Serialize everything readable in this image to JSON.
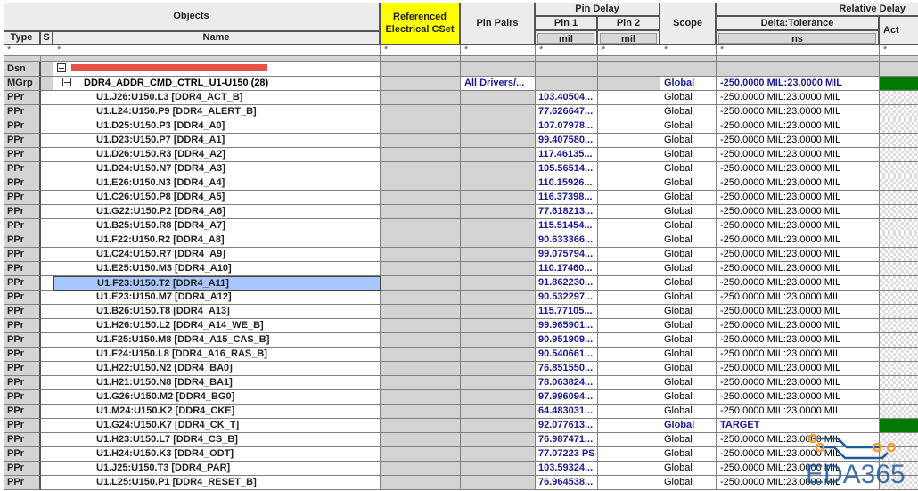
{
  "headers": {
    "objects": "Objects",
    "type": "Type",
    "s": "S",
    "name": "Name",
    "ref_cset": "Referenced Electrical CSet",
    "pin_pairs": "Pin Pairs",
    "pin_delay": "Pin Delay",
    "pin1": "Pin 1",
    "pin2": "Pin 2",
    "pin1_unit": "mil",
    "pin2_unit": "mil",
    "scope": "Scope",
    "relative_delay": "Relative Delay",
    "delta_tolerance": "Delta:Tolerance",
    "delta_unit": "ns",
    "actual": "Act",
    "filter": "*"
  },
  "design_row": {
    "type": "Dsn",
    "name": "[redacted]"
  },
  "group_row": {
    "type": "MGrp",
    "name": "DDR4_ADDR_CMD_CTRL_U1-U150 (28)",
    "pin_pairs": "All Drivers/...",
    "scope": "Global",
    "delta": "-250.0000 MIL:23.0000 MIL",
    "actual_status": "pass"
  },
  "colors": {
    "pass": "#007a00",
    "selected": "#a8c6ff",
    "header_yellow": "#ffff00",
    "value_blue": "#1a1a8c"
  },
  "rows": [
    {
      "type": "PPr",
      "name": "U1.J26:U150.L3 [DDR4_ACT_B]",
      "pin1": "103.40504...",
      "scope": "Global",
      "delta": "-250.0000 MIL:23.0000 MIL"
    },
    {
      "type": "PPr",
      "name": "U1.L24:U150.P9 [DDR4_ALERT_B]",
      "pin1": "77.626647...",
      "scope": "Global",
      "delta": "-250.0000 MIL:23.0000 MIL"
    },
    {
      "type": "PPr",
      "name": "U1.D25:U150.P3 [DDR4_A0]",
      "pin1": "107.07978...",
      "scope": "Global",
      "delta": "-250.0000 MIL:23.0000 MIL"
    },
    {
      "type": "PPr",
      "name": "U1.D23:U150.P7 [DDR4_A1]",
      "pin1": "99.407580...",
      "scope": "Global",
      "delta": "-250.0000 MIL:23.0000 MIL"
    },
    {
      "type": "PPr",
      "name": "U1.D26:U150.R3 [DDR4_A2]",
      "pin1": "117.46135...",
      "scope": "Global",
      "delta": "-250.0000 MIL:23.0000 MIL"
    },
    {
      "type": "PPr",
      "name": "U1.D24:U150.N7 [DDR4_A3]",
      "pin1": "105.56514...",
      "scope": "Global",
      "delta": "-250.0000 MIL:23.0000 MIL"
    },
    {
      "type": "PPr",
      "name": "U1.E26:U150.N3 [DDR4_A4]",
      "pin1": "110.15926...",
      "scope": "Global",
      "delta": "-250.0000 MIL:23.0000 MIL"
    },
    {
      "type": "PPr",
      "name": "U1.C26:U150.P8 [DDR4_A5]",
      "pin1": "116.37398...",
      "scope": "Global",
      "delta": "-250.0000 MIL:23.0000 MIL"
    },
    {
      "type": "PPr",
      "name": "U1.G22:U150.P2 [DDR4_A6]",
      "pin1": "77.618213...",
      "scope": "Global",
      "delta": "-250.0000 MIL:23.0000 MIL"
    },
    {
      "type": "PPr",
      "name": "U1.B25:U150.R8 [DDR4_A7]",
      "pin1": "115.51454...",
      "scope": "Global",
      "delta": "-250.0000 MIL:23.0000 MIL"
    },
    {
      "type": "PPr",
      "name": "U1.F22:U150.R2 [DDR4_A8]",
      "pin1": "90.633366...",
      "scope": "Global",
      "delta": "-250.0000 MIL:23.0000 MIL"
    },
    {
      "type": "PPr",
      "name": "U1.C24:U150.R7 [DDR4_A9]",
      "pin1": "99.075794...",
      "scope": "Global",
      "delta": "-250.0000 MIL:23.0000 MIL"
    },
    {
      "type": "PPr",
      "name": "U1.E25:U150.M3 [DDR4_A10]",
      "pin1": "110.17460...",
      "scope": "Global",
      "delta": "-250.0000 MIL:23.0000 MIL"
    },
    {
      "type": "PPr",
      "name": "U1.F23:U150.T2 [DDR4_A11]",
      "pin1": "91.862230...",
      "scope": "Global",
      "delta": "-250.0000 MIL:23.0000 MIL",
      "selected": true
    },
    {
      "type": "PPr",
      "name": "U1.E23:U150.M7 [DDR4_A12]",
      "pin1": "90.532297...",
      "scope": "Global",
      "delta": "-250.0000 MIL:23.0000 MIL"
    },
    {
      "type": "PPr",
      "name": "U1.B26:U150.T8 [DDR4_A13]",
      "pin1": "115.77105...",
      "scope": "Global",
      "delta": "-250.0000 MIL:23.0000 MIL"
    },
    {
      "type": "PPr",
      "name": "U1.H26:U150.L2 [DDR4_A14_WE_B]",
      "pin1": "99.965901...",
      "scope": "Global",
      "delta": "-250.0000 MIL:23.0000 MIL"
    },
    {
      "type": "PPr",
      "name": "U1.F25:U150.M8 [DDR4_A15_CAS_B]",
      "pin1": "90.951909...",
      "scope": "Global",
      "delta": "-250.0000 MIL:23.0000 MIL"
    },
    {
      "type": "PPr",
      "name": "U1.F24:U150.L8 [DDR4_A16_RAS_B]",
      "pin1": "90.540661...",
      "scope": "Global",
      "delta": "-250.0000 MIL:23.0000 MIL"
    },
    {
      "type": "PPr",
      "name": "U1.H22:U150.N2 [DDR4_BA0]",
      "pin1": "76.851550...",
      "scope": "Global",
      "delta": "-250.0000 MIL:23.0000 MIL"
    },
    {
      "type": "PPr",
      "name": "U1.H21:U150.N8 [DDR4_BA1]",
      "pin1": "78.063824...",
      "scope": "Global",
      "delta": "-250.0000 MIL:23.0000 MIL"
    },
    {
      "type": "PPr",
      "name": "U1.G26:U150.M2 [DDR4_BG0]",
      "pin1": "97.996094...",
      "scope": "Global",
      "delta": "-250.0000 MIL:23.0000 MIL"
    },
    {
      "type": "PPr",
      "name": "U1.M24:U150.K2 [DDR4_CKE]",
      "pin1": "64.483031...",
      "scope": "Global",
      "delta": "-250.0000 MIL:23.0000 MIL"
    },
    {
      "type": "PPr",
      "name": "U1.G24:U150.K7 [DDR4_CK_T]",
      "pin1": "92.077613...",
      "scope": "Global",
      "delta": "TARGET",
      "target": true
    },
    {
      "type": "PPr",
      "name": "U1.H23:U150.L7 [DDR4_CS_B]",
      "pin1": "76.987471...",
      "scope": "Global",
      "delta": "-250.0000 MIL:23.0000 MIL"
    },
    {
      "type": "PPr",
      "name": "U1.H24:U150.K3 [DDR4_ODT]",
      "pin1": "77.07223 PS",
      "scope": "Global",
      "delta": "-250.0000 MIL:23.0000 MIL"
    },
    {
      "type": "PPr",
      "name": "U1.J25:U150.T3 [DDR4_PAR]",
      "pin1": "103.59324...",
      "scope": "Global",
      "delta": "-250.0000 MIL:23.0000 MIL"
    },
    {
      "type": "PPr",
      "name": "U1.L25:U150.P1 [DDR4_RESET_B]",
      "pin1": "76.964538...",
      "scope": "Global",
      "delta": "-250.0000 MIL:23.0000 MIL"
    }
  ],
  "watermark": "EDA365"
}
